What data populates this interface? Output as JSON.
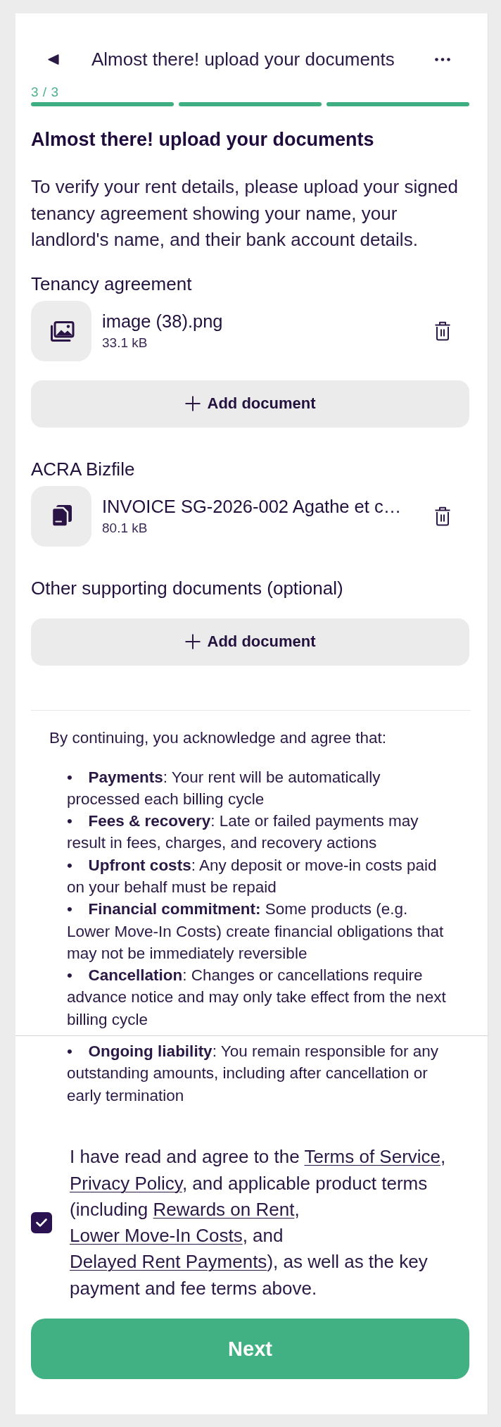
{
  "header": {
    "title": "Almost there! upload your documents"
  },
  "progress": {
    "label": "3 / 3",
    "steps": [
      {
        "complete": true
      },
      {
        "complete": true
      },
      {
        "complete": true
      }
    ]
  },
  "heading": "Almost there! upload your documents",
  "intro": "To verify your rent details, please upload your signed tenancy agreement showing your name, your landlord's name, and their bank account details.",
  "sections": [
    {
      "label": "Tenancy agreement",
      "files": [
        {
          "kind": "image",
          "name": "image (38).png",
          "size": "33.1 kB"
        }
      ],
      "add_button": "Add document"
    },
    {
      "label": "ACRA Bizfile",
      "files": [
        {
          "kind": "document",
          "name": "INVOICE SG-2026-002 Agathe et c…",
          "size": "80.1 kB"
        }
      ]
    },
    {
      "label": "Other supporting documents (optional)",
      "add_button": "Add document"
    }
  ],
  "terms": {
    "intro": "By continuing, you acknowledge and agree that:",
    "groups": [
      [
        "• **Payments**: Your rent will be automatically processed each billing cycle",
        "• **Fees & recovery**: Late or failed payments may result in fees, charges, and recovery actions",
        "• **Upfront costs**: Any deposit or move-in costs paid on your behalf must be repaid",
        "• **Financial commitment:** Some products (e.g. Lower Move-In Costs) create financial obligations that may not be immediately reversible",
        "• **Cancellation**: Changes or cancellations require advance notice and may only take effect from the next billing cycle"
      ],
      [
        "• **Ongoing liability**: You remain responsible for any outstanding amounts, including after cancellation or early termination"
      ]
    ]
  },
  "consent": {
    "checked": true,
    "parts": [
      {
        "kind": "text",
        "text": "I have read and agree to the "
      },
      {
        "kind": "link",
        "text": "Terms of Service"
      },
      {
        "kind": "text",
        "text": ", "
      },
      {
        "kind": "link",
        "text": "Privacy Policy"
      },
      {
        "kind": "text",
        "text": ", and applicable product terms (including "
      },
      {
        "kind": "link",
        "text": "Rewards on Rent"
      },
      {
        "kind": "text",
        "text": ", "
      },
      {
        "kind": "link",
        "text": "Lower Move-In Costs"
      },
      {
        "kind": "text",
        "text": ", and "
      },
      {
        "kind": "link",
        "text": "Delayed Rent Payments"
      },
      {
        "kind": "text",
        "text": "), as well as the key payment and fee terms above."
      }
    ]
  },
  "next_button": "Next"
}
